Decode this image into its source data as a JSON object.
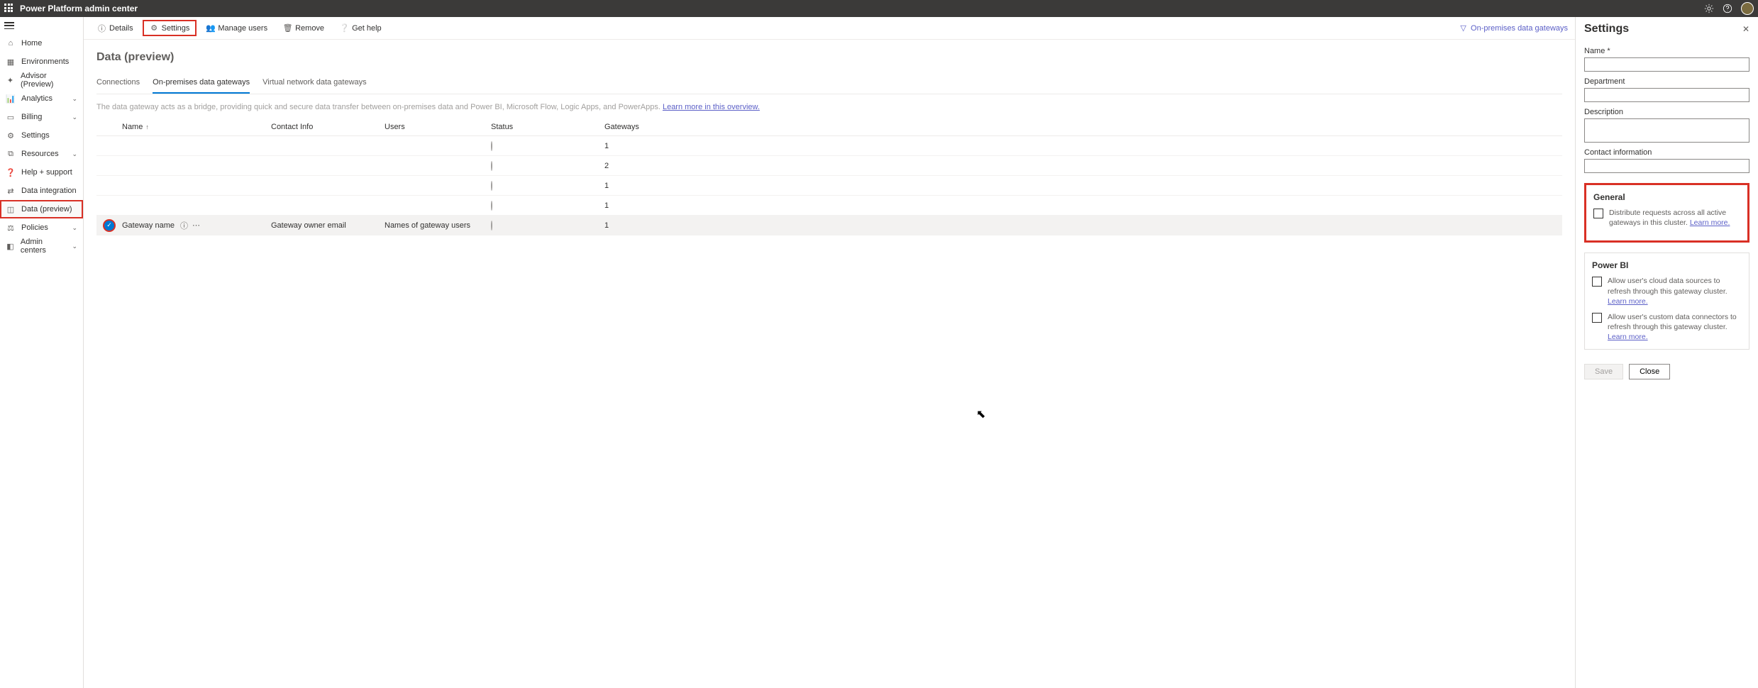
{
  "header": {
    "title": "Power Platform admin center"
  },
  "sidebar": {
    "items": [
      {
        "label": "Home",
        "icon": "home"
      },
      {
        "label": "Environments",
        "icon": "env"
      },
      {
        "label": "Advisor (Preview)",
        "icon": "advisor"
      },
      {
        "label": "Analytics",
        "icon": "analytics",
        "chev": true
      },
      {
        "label": "Billing",
        "icon": "billing",
        "chev": true
      },
      {
        "label": "Settings",
        "icon": "settings"
      },
      {
        "label": "Resources",
        "icon": "resources",
        "chev": true
      },
      {
        "label": "Help + support",
        "icon": "help"
      },
      {
        "label": "Data integration",
        "icon": "integration"
      },
      {
        "label": "Data (preview)",
        "icon": "data",
        "selected": true
      },
      {
        "label": "Policies",
        "icon": "policies",
        "chev": true
      },
      {
        "label": "Admin centers",
        "icon": "admincenters",
        "chev": true
      }
    ]
  },
  "commands": {
    "details": "Details",
    "settings": "Settings",
    "manage_users": "Manage users",
    "remove": "Remove",
    "get_help": "Get help",
    "right_link": "On-premises data gateways"
  },
  "page": {
    "title": "Data (preview)",
    "tabs": [
      "Connections",
      "On-premises data gateways",
      "Virtual network data gateways"
    ],
    "hint": "The data gateway acts as a bridge, providing quick and secure data transfer between on-premises data and Power BI, Microsoft Flow, Logic Apps, and PowerApps.",
    "hint_link": "Learn more in this overview."
  },
  "table": {
    "headers": {
      "name": "Name",
      "contact": "Contact Info",
      "users": "Users",
      "status": "Status",
      "gateways": "Gateways"
    },
    "rows": [
      {
        "name": "",
        "contact": "",
        "users": "",
        "gateways": "1"
      },
      {
        "name": "",
        "contact": "",
        "users": "",
        "gateways": "2"
      },
      {
        "name": "",
        "contact": "",
        "users": "",
        "gateways": "1"
      },
      {
        "name": "",
        "contact": "",
        "users": "",
        "gateways": "1"
      },
      {
        "name": "Gateway name",
        "contact": "Gateway owner email",
        "users": "Names of gateway users",
        "gateways": "1",
        "selected": true
      }
    ]
  },
  "panel": {
    "title": "Settings",
    "top_small": "",
    "name_label": "Name *",
    "name_value": "",
    "dept_label": "Department",
    "dept_value": "",
    "desc_label": "Description",
    "desc_value": "",
    "contact_label": "Contact information",
    "contact_value": "",
    "general": {
      "title": "General",
      "chk1": "Distribute requests across all active gateways in this cluster.",
      "learn": "Learn more."
    },
    "powerbi": {
      "title": "Power BI",
      "chk1": "Allow user's cloud data sources to refresh through this gateway cluster.",
      "chk2": "Allow user's custom data connectors to refresh through this gateway cluster.",
      "learn": "Learn more."
    },
    "save": "Save",
    "close": "Close"
  }
}
